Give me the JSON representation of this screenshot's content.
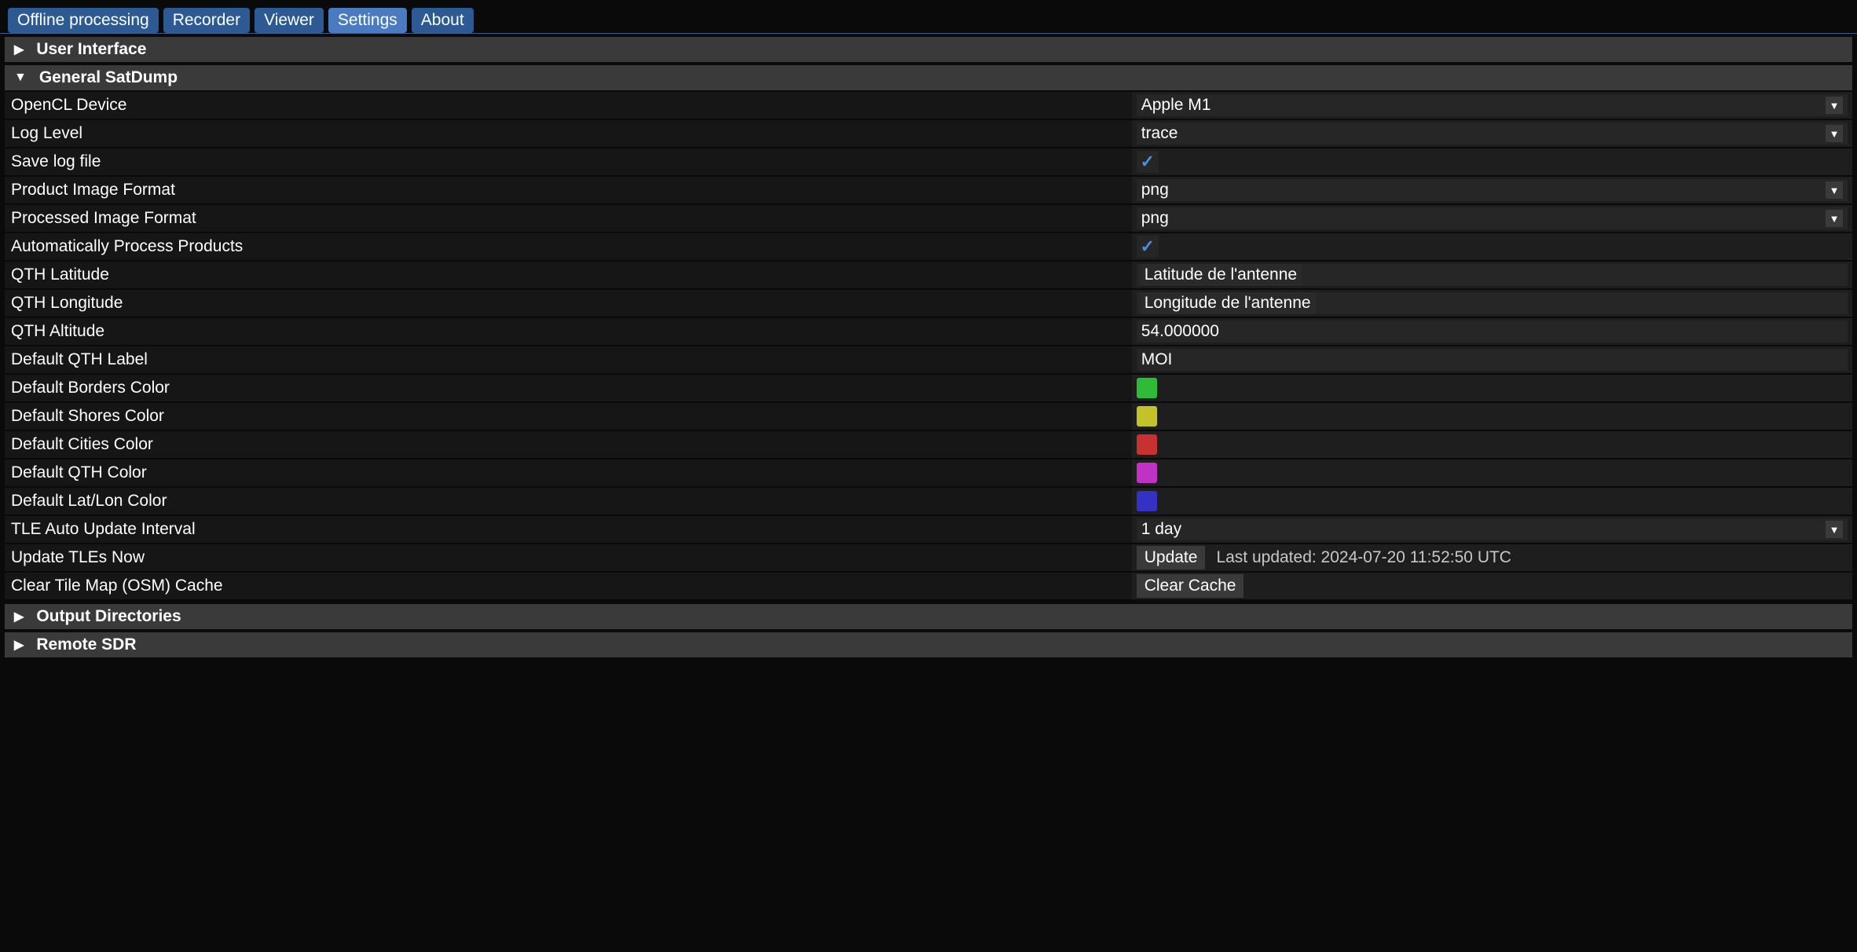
{
  "tabs": [
    {
      "label": "Offline processing",
      "active": false
    },
    {
      "label": "Recorder",
      "active": false
    },
    {
      "label": "Viewer",
      "active": false
    },
    {
      "label": "Settings",
      "active": true
    },
    {
      "label": "About",
      "active": false
    }
  ],
  "sections": {
    "user_interface": {
      "label": "User Interface",
      "expanded": false
    },
    "general": {
      "label": "General SatDump",
      "expanded": true
    },
    "output_dirs": {
      "label": "Output Directories",
      "expanded": false
    },
    "remote_sdr": {
      "label": "Remote SDR",
      "expanded": false
    }
  },
  "general": {
    "opencl_device": {
      "label": "OpenCL Device",
      "value": "Apple M1"
    },
    "log_level": {
      "label": "Log Level",
      "value": "trace"
    },
    "save_log_file": {
      "label": "Save log file",
      "checked": true
    },
    "product_image_format": {
      "label": "Product Image Format",
      "value": "png"
    },
    "processed_image_format": {
      "label": "Processed Image Format",
      "value": "png"
    },
    "auto_process": {
      "label": "Automatically Process Products",
      "checked": true
    },
    "qth_lat": {
      "label": "QTH Latitude",
      "value": "",
      "hint": "Latitude de l'antenne"
    },
    "qth_lon": {
      "label": "QTH Longitude",
      "value": "",
      "hint": "Longitude de l'antenne"
    },
    "qth_alt": {
      "label": "QTH Altitude",
      "value": "54.000000"
    },
    "default_qth_label": {
      "label": "Default QTH Label",
      "value": "MOI"
    },
    "borders_color": {
      "label": "Default Borders Color",
      "color": "#2fbb3a"
    },
    "shores_color": {
      "label": "Default Shores Color",
      "color": "#c3c22b"
    },
    "cities_color": {
      "label": "Default Cities Color",
      "color": "#c93030"
    },
    "qth_color": {
      "label": "Default QTH Color",
      "color": "#c031c4"
    },
    "latlon_color": {
      "label": "Default Lat/Lon Color",
      "color": "#3432c4"
    },
    "tle_interval": {
      "label": "TLE Auto Update Interval",
      "value": "1 day"
    },
    "update_tle": {
      "label": "Update TLEs Now",
      "button": "Update",
      "status": "Last updated: 2024-07-20 11:52:50 UTC"
    },
    "clear_cache": {
      "label": "Clear Tile Map (OSM) Cache",
      "button": "Clear Cache"
    }
  }
}
